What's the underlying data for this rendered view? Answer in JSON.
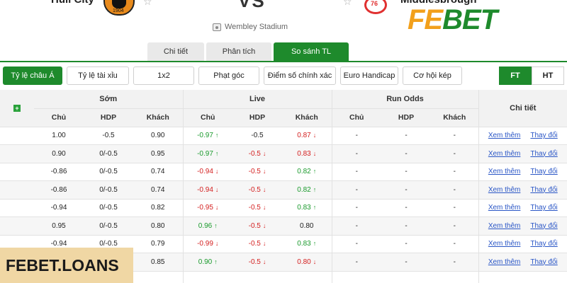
{
  "match": {
    "home_team": "Hull City",
    "away_team": "Middlesbrough",
    "vs": "VS",
    "home_logo_year": "1904",
    "away_logo_number": "76",
    "stadium": "Wembley Stadium"
  },
  "brand": {
    "part1": "FE",
    "part2": "BET"
  },
  "tabs": [
    {
      "label": "Chi tiết",
      "active": false
    },
    {
      "label": "Phân tích",
      "active": false
    },
    {
      "label": "So sánh TL",
      "active": true
    }
  ],
  "filters": [
    {
      "label": "Tỷ lệ châu Á",
      "active": true
    },
    {
      "label": "Tỷ lệ tài xỉu",
      "active": false
    },
    {
      "label": "1x2",
      "active": false
    },
    {
      "label": "Phạt góc",
      "active": false
    },
    {
      "label": "Điểm số chính xác",
      "active": false
    },
    {
      "label": "Euro Handicap",
      "active": false
    },
    {
      "label": "Cơ hội kép",
      "active": false
    }
  ],
  "period": {
    "ft": "FT",
    "ht": "HT"
  },
  "table": {
    "groups": {
      "early": "Sớm",
      "live": "Live",
      "run": "Run Odds",
      "detail": "Chi tiết"
    },
    "cols": {
      "home": "Chủ",
      "hdp": "HDP",
      "away": "Khách"
    },
    "rows": [
      {
        "e": [
          "1.00",
          "-0.5",
          "0.90"
        ],
        "l": [
          "-0.97",
          "up",
          "-0.5",
          "",
          "0.87",
          "dn"
        ],
        "r": [
          "-",
          "-",
          "-"
        ]
      },
      {
        "e": [
          "0.90",
          "0/-0.5",
          "0.95"
        ],
        "l": [
          "-0.97",
          "up",
          "-0.5",
          "dn",
          "0.83",
          "dn"
        ],
        "r": [
          "-",
          "-",
          "-"
        ]
      },
      {
        "e": [
          "-0.86",
          "0/-0.5",
          "0.74"
        ],
        "l": [
          "-0.94",
          "dn",
          "-0.5",
          "dn",
          "0.82",
          "up"
        ],
        "r": [
          "-",
          "-",
          "-"
        ]
      },
      {
        "e": [
          "-0.86",
          "0/-0.5",
          "0.74"
        ],
        "l": [
          "-0.94",
          "dn",
          "-0.5",
          "dn",
          "0.82",
          "up"
        ],
        "r": [
          "-",
          "-",
          "-"
        ]
      },
      {
        "e": [
          "-0.94",
          "0/-0.5",
          "0.82"
        ],
        "l": [
          "-0.95",
          "dn",
          "-0.5",
          "dn",
          "0.83",
          "up"
        ],
        "r": [
          "-",
          "-",
          "-"
        ]
      },
      {
        "e": [
          "0.95",
          "0/-0.5",
          "0.80"
        ],
        "l": [
          "0.96",
          "up",
          "-0.5",
          "dn",
          "0.80",
          ""
        ],
        "r": [
          "-",
          "-",
          "-"
        ]
      },
      {
        "e": [
          "-0.94",
          "0/-0.5",
          "0.79"
        ],
        "l": [
          "-0.99",
          "dn",
          "-0.5",
          "dn",
          "0.83",
          "up"
        ],
        "r": [
          "-",
          "-",
          "-"
        ]
      },
      {
        "e": [
          "",
          "",
          "0.85"
        ],
        "l": [
          "0.90",
          "up",
          "-0.5",
          "dn",
          "0.80",
          "dn"
        ],
        "r": [
          "-",
          "-",
          "-"
        ]
      },
      {
        "e": [
          "",
          "",
          ""
        ],
        "l": [
          "",
          "",
          "",
          "",
          "",
          ""
        ],
        "r": [
          "",
          "",
          ""
        ]
      }
    ],
    "link_more": "Xem thêm",
    "link_changes": "Thay đổi"
  },
  "watermark": "FEBET.LOANS",
  "colors": {
    "accent": "#1e8a2c",
    "brand_orange": "#f2a01c",
    "up": "#1a9a2c",
    "down": "#d42020",
    "link": "#2a56c6"
  }
}
